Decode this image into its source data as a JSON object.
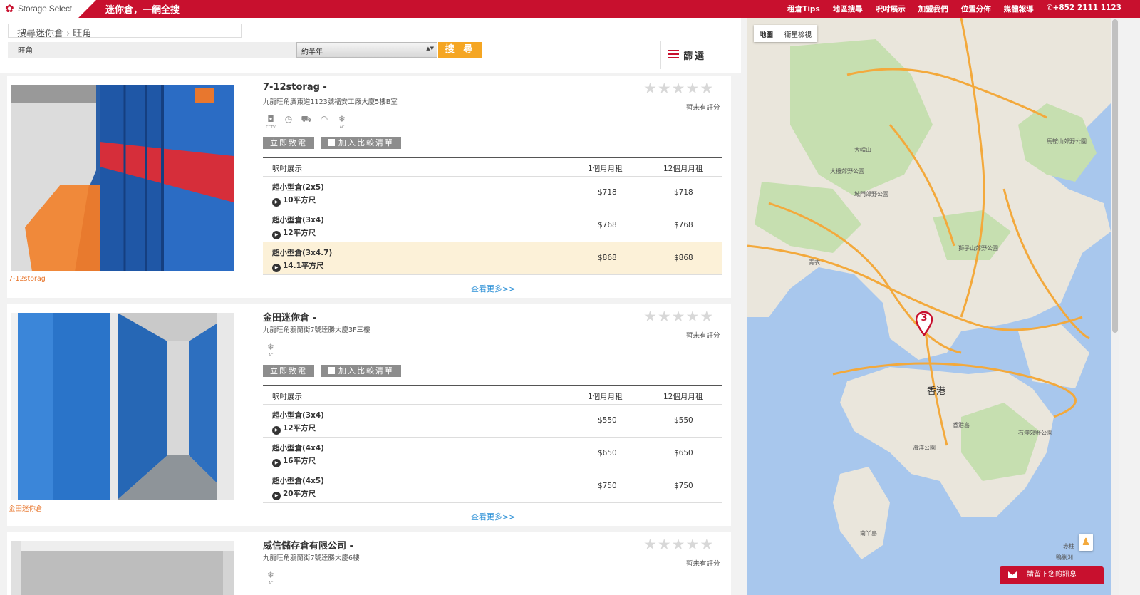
{
  "header": {
    "logo_text": "Storage Select",
    "slogan": "迷你倉，一網全搜",
    "nav": [
      "租倉Tips",
      "地區搜尋",
      "呎吋展示",
      "加盟我們",
      "位置分佈",
      "媒體報導",
      "+852 2111 1123"
    ],
    "brand_color": "#c8102e"
  },
  "search": {
    "breadcrumb_root": "搜尋迷你倉",
    "breadcrumb_current": "旺角",
    "location_value": "旺角",
    "period_value": "約半年",
    "search_label": "搜 尋",
    "filter_label": "篩選"
  },
  "table_headers": {
    "size_demo": "呎吋展示",
    "monthly_1": "1個月月租",
    "monthly_12": "12個月月租"
  },
  "common": {
    "no_rating": "暫未有評分",
    "call_now": "立即致電",
    "add_compare": "加入比較清單",
    "see_more": "查看更多>>"
  },
  "listings": [
    {
      "title": "7-12storag -",
      "address": "九龍旺角廣東道1123號福安工廠大廈5樓B室",
      "caption": "7-12storag",
      "amenities": [
        "cctv-icon",
        "clock-24h-icon",
        "truck-icon",
        "wifi-icon",
        "air-conditioner-icon"
      ],
      "amenity_labels": [
        "CCTV",
        "AC"
      ],
      "units": [
        {
          "name": "超小型倉(2x5)",
          "size": "10平方尺",
          "m1": "$718",
          "m12": "$718"
        },
        {
          "name": "超小型倉(3x4)",
          "size": "12平方尺",
          "m1": "$768",
          "m12": "$768"
        },
        {
          "name": "超小型倉(3x4.7)",
          "size": "14.1平方尺",
          "m1": "$868",
          "m12": "$868"
        }
      ]
    },
    {
      "title": "金田迷你倉 -",
      "address": "九龍旺角鴉蘭街7號達勝大廈3F三樓",
      "caption": "金田迷你倉",
      "amenities": [
        "air-conditioner-icon"
      ],
      "amenity_labels": [
        "AC"
      ],
      "units": [
        {
          "name": "超小型倉(3x4)",
          "size": "12平方尺",
          "m1": "$550",
          "m12": "$550"
        },
        {
          "name": "超小型倉(4x4)",
          "size": "16平方尺",
          "m1": "$650",
          "m12": "$650"
        },
        {
          "name": "超小型倉(4x5)",
          "size": "20平方尺",
          "m1": "$750",
          "m12": "$750"
        }
      ]
    },
    {
      "title": "威信儲存倉有限公司 -",
      "address": "九龍旺角鴉蘭街7號達勝大廈6樓",
      "amenities": [
        "air-conditioner-icon"
      ],
      "amenity_labels": [
        "AC"
      ]
    }
  ],
  "map": {
    "type_map": "地圖",
    "type_satellite": "衛星檢視",
    "marker_count": "3",
    "labels": [
      "香港",
      "香港島",
      "大帽山",
      "青衣",
      "南丫島",
      "海洋公園",
      "獅子山郊野公園",
      "城門郊野公園",
      "石澳郊野公園",
      "馬鞍山郊野公園",
      "大欖郊野公園",
      "鴨脷洲",
      "赤柱"
    ],
    "water_color": "#a8c7ed",
    "land_color": "#eae6dc",
    "park_color": "#c6dfb0",
    "road_color": "#f3a93c"
  },
  "message_bar": {
    "label": "請留下您的訊息"
  }
}
